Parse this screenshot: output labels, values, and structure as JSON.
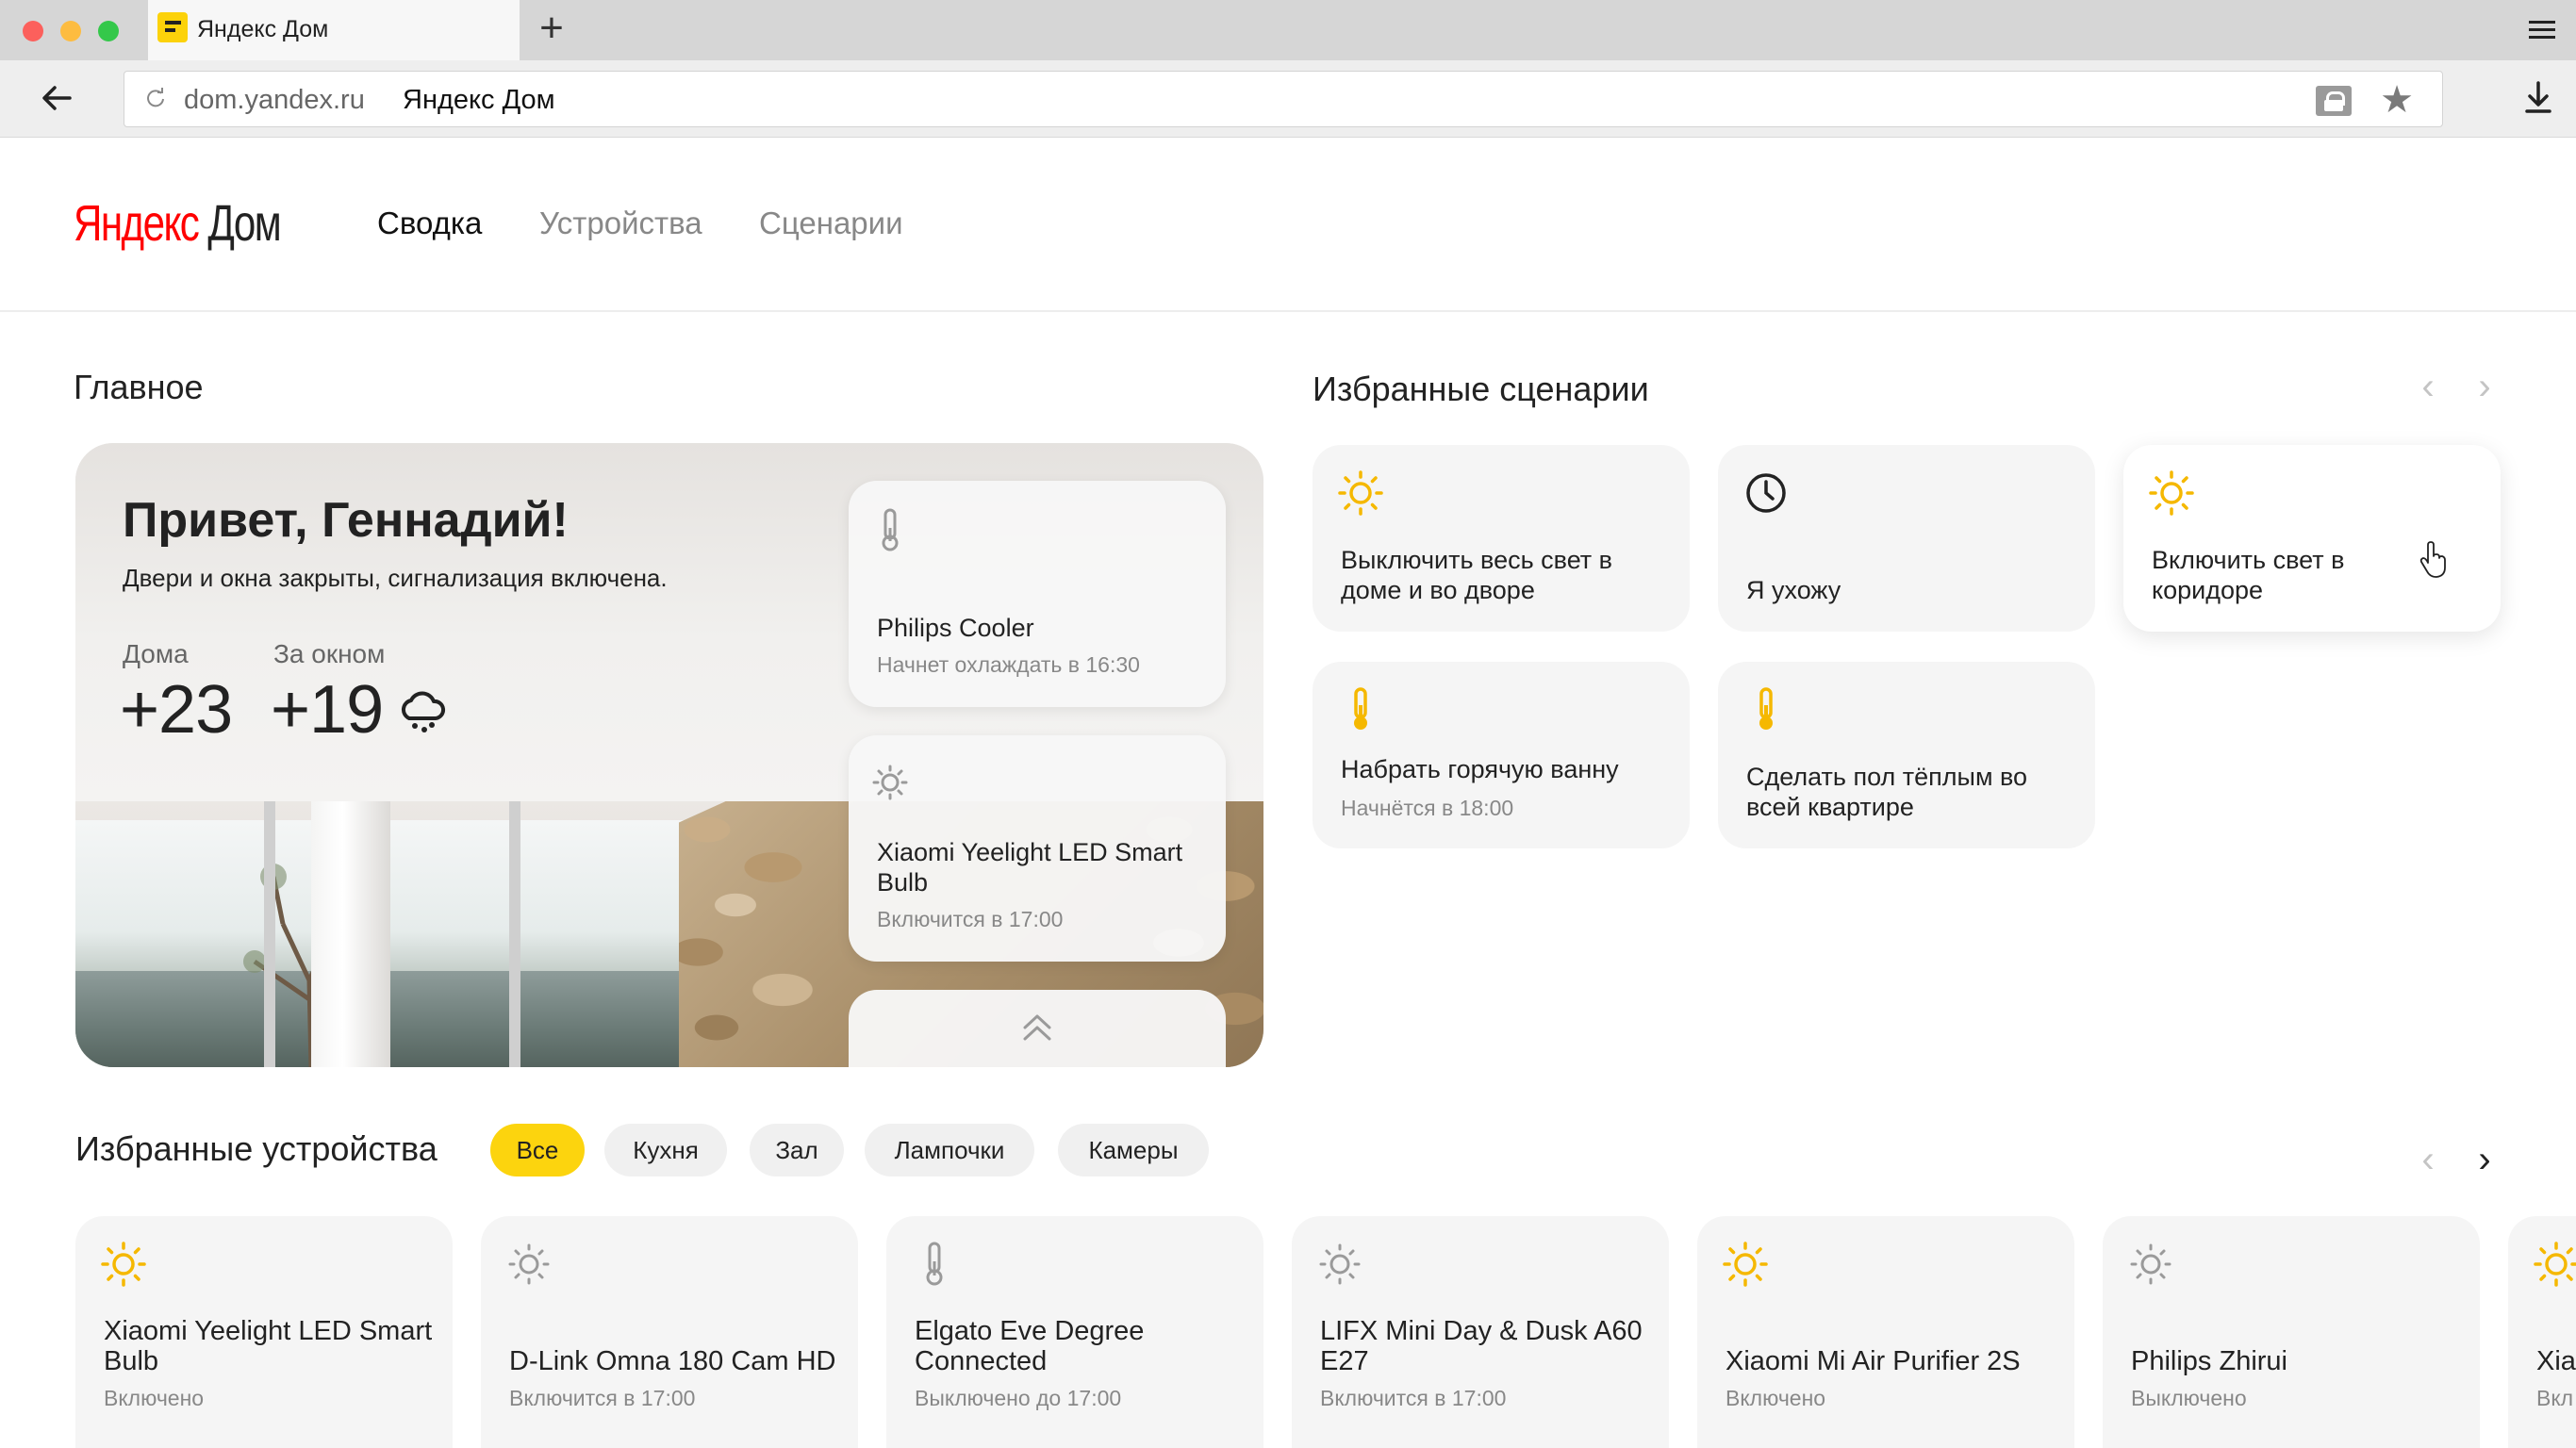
{
  "browser": {
    "tab_title": "Яндекс Дом",
    "new_tab": "+",
    "url_domain": "dom.yandex.ru",
    "url_title": "Яндекс Дом"
  },
  "header": {
    "logo_ya": "Яндекс",
    "logo_dom": " Дом",
    "nav": [
      "Сводка",
      "Устройства",
      "Сценарии"
    ]
  },
  "main": {
    "title": "Главное",
    "greeting": "Привет, Геннадий!",
    "status": "Двери и окна закрыты, сигнализация включена.",
    "home_label": "Дома",
    "home_temp": "+23",
    "outside_label": "За окном",
    "outside_temp": "+19",
    "weather_icon": "rain-cloud-icon",
    "cards": [
      {
        "icon": "thermometer-icon",
        "title": "Philips Cooler",
        "subtitle": "Начнет охлаждать в 16:30"
      },
      {
        "icon": "sun-icon",
        "title": "Xiaomi Yeelight LED Smart Bulb",
        "subtitle": "Включится в 17:00"
      }
    ]
  },
  "scenarios": {
    "title": "Избранные сценарии",
    "items": [
      {
        "icon": "sun-icon",
        "title": "Выключить весь свет в доме и во дворе",
        "subtitle": ""
      },
      {
        "icon": "clock-icon",
        "title": "Я ухожу",
        "subtitle": ""
      },
      {
        "icon": "sun-icon",
        "title": "Включить свет в коридоре",
        "subtitle": ""
      },
      {
        "icon": "thermometer-icon",
        "title": "Набрать горячую ванну",
        "subtitle": "Начнётся в 18:00"
      },
      {
        "icon": "thermometer-icon",
        "title": "Сделать пол тёплым во всей квартире",
        "subtitle": ""
      }
    ]
  },
  "devices": {
    "title": "Избранные устройства",
    "filters": [
      "Все",
      "Кухня",
      "Зал",
      "Лампочки",
      "Камеры"
    ],
    "active_filter": "Все",
    "items": [
      {
        "icon": "sun-icon",
        "active": true,
        "title": "Xiaomi Yeelight LED Smart Bulb",
        "status": "Включено"
      },
      {
        "icon": "sun-icon",
        "active": false,
        "title": "D-Link Omna 180 Cam HD",
        "status": "Включится в 17:00"
      },
      {
        "icon": "thermometer-icon",
        "active": false,
        "title": "Elgato Eve Degree Connected",
        "status": "Выключено до 17:00"
      },
      {
        "icon": "sun-icon",
        "active": false,
        "title": "LIFX Mini Day & Dusk A60 E27",
        "status": "Включится в 17:00"
      },
      {
        "icon": "sun-icon",
        "active": true,
        "title": "Xiaomi Mi Air Purifier 2S",
        "status": "Включено"
      },
      {
        "icon": "sun-icon",
        "active": false,
        "title": "Philips Zhirui",
        "status": "Выключено"
      },
      {
        "icon": "sun-icon",
        "active": true,
        "title": "Xia",
        "status": "Вкл"
      }
    ]
  },
  "colors": {
    "accent_yellow": "#fcd40e",
    "icon_active": "#f5b800",
    "icon_inactive": "#9a9a9a"
  }
}
